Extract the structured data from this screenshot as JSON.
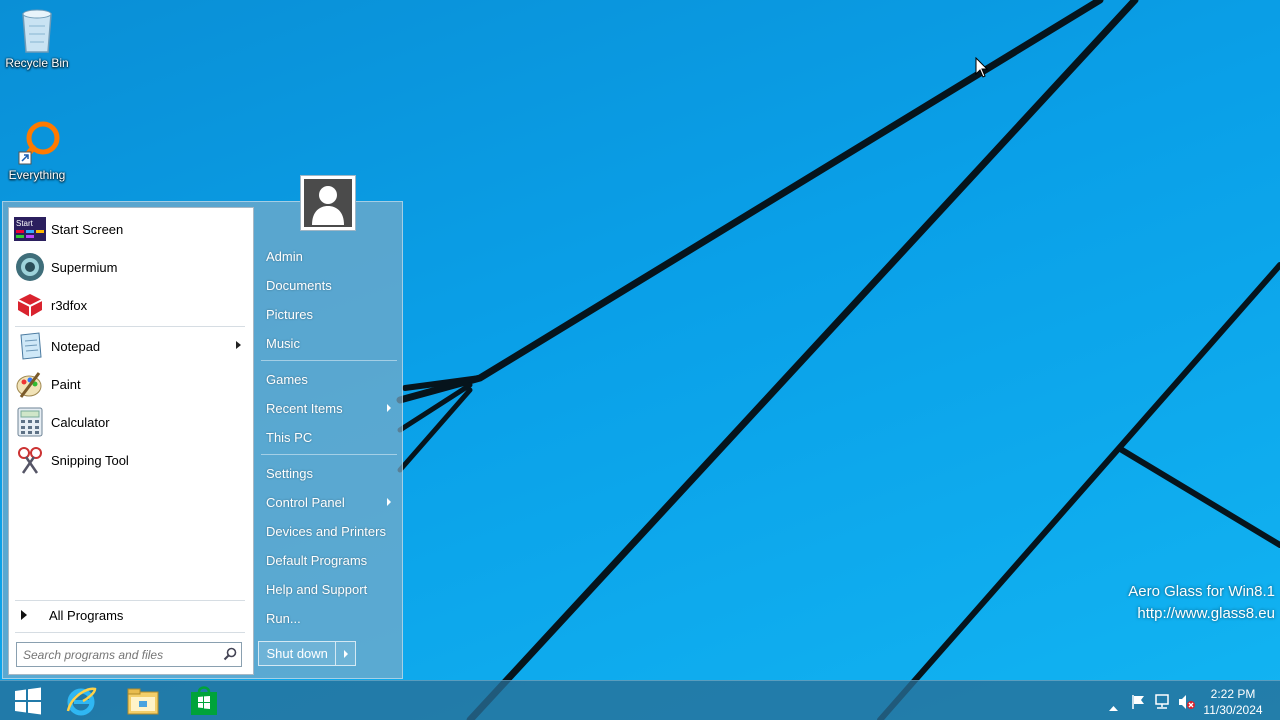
{
  "desktop": {
    "icons": [
      {
        "label": "Recycle Bin",
        "icon": "recycle-bin-icon"
      },
      {
        "label": "Everything",
        "icon": "everything-search-icon"
      }
    ],
    "watermark": {
      "line1": "Aero Glass for Win8.1",
      "line2": "http://www.glass8.eu"
    }
  },
  "start_menu": {
    "pinned": [
      {
        "label": "Start Screen",
        "icon": "start-screen-icon"
      },
      {
        "label": "Supermium",
        "icon": "supermium-icon"
      },
      {
        "label": "r3dfox",
        "icon": "r3dfox-icon"
      }
    ],
    "recent": [
      {
        "label": "Notepad",
        "icon": "notepad-icon",
        "has_submenu": true
      },
      {
        "label": "Paint",
        "icon": "paint-icon",
        "has_submenu": false
      },
      {
        "label": "Calculator",
        "icon": "calculator-icon",
        "has_submenu": false
      },
      {
        "label": "Snipping Tool",
        "icon": "snipping-tool-icon",
        "has_submenu": false
      }
    ],
    "all_programs": "All Programs",
    "search_placeholder": "Search programs and files",
    "right_column": [
      {
        "label": "Admin"
      },
      {
        "label": "Documents"
      },
      {
        "label": "Pictures"
      },
      {
        "label": "Music"
      },
      {
        "label": "Games"
      },
      {
        "label": "Recent Items",
        "has_submenu": true
      },
      {
        "label": "This PC"
      },
      {
        "label": "Settings"
      },
      {
        "label": "Control Panel",
        "has_submenu": true
      },
      {
        "label": "Devices and Printers"
      },
      {
        "label": "Default Programs"
      },
      {
        "label": "Help and Support"
      },
      {
        "label": "Run..."
      }
    ],
    "shutdown_label": "Shut down"
  },
  "taskbar": {
    "buttons": [
      "start-button-icon",
      "internet-explorer-icon",
      "file-explorer-icon",
      "store-icon"
    ],
    "tray_icons": [
      "show-hidden-icons-chevron",
      "action-center-flag-icon",
      "network-icon",
      "volume-muted-icon"
    ],
    "clock": {
      "time": "2:22 PM",
      "date": "11/30/2024"
    }
  }
}
